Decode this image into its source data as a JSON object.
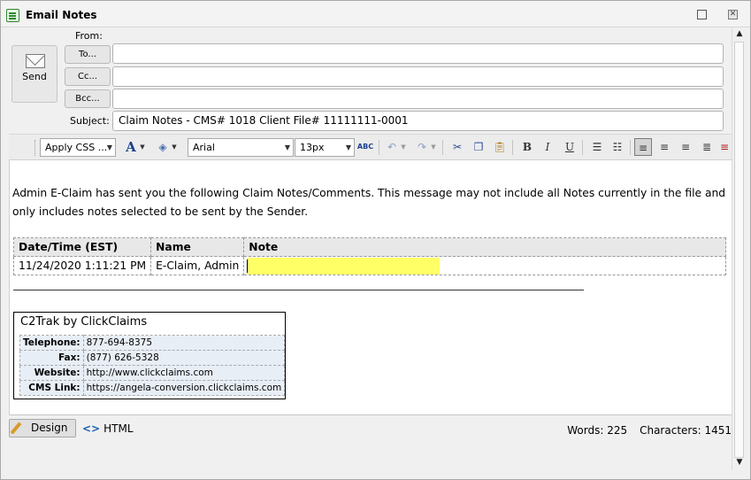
{
  "window": {
    "title": "Email Notes",
    "maximize_glyph": "□",
    "close_glyph": "✕"
  },
  "compose": {
    "send_label": "Send",
    "from_label": "From:",
    "to_button": "To...",
    "cc_button": "Cc...",
    "bcc_button": "Bcc...",
    "to_value": "",
    "cc_value": "",
    "bcc_value": "",
    "subject_label": "Subject:",
    "subject_value": "Claim Notes - CMS# 1018 Client File# 11111111-0001"
  },
  "toolbar": {
    "apply_css": "Apply CSS ...",
    "font_name": "Arial",
    "font_size": "13px",
    "icons": [
      "font-color-icon",
      "highlight-color-icon",
      "spellcheck-icon",
      "undo-icon",
      "redo-icon",
      "cut-icon",
      "copy-icon",
      "paste-icon",
      "bold-icon",
      "italic-icon",
      "underline-icon",
      "numbered-list-icon",
      "bullet-list-icon",
      "align-left-icon",
      "align-center-icon",
      "align-right-icon",
      "justify-icon"
    ],
    "bold": "B",
    "italic": "I",
    "underline": "U",
    "font_color": "A",
    "spell": "ABC"
  },
  "editor": {
    "intro_text": "Admin E-Claim has sent you the following Claim Notes/Comments. This message may not include all Notes currently in the file and only includes notes selected to be sent by the Sender.",
    "table_headers": [
      "Date/Time (EST)",
      "Name",
      "Note"
    ],
    "table_rows": [
      [
        "11/24/2020 1:11:21 PM",
        "E-Claim, Admin",
        ""
      ]
    ],
    "signature": {
      "title": "C2Trak by ClickClaims",
      "rows": [
        {
          "label": "Telephone:",
          "value": "877-694-8375"
        },
        {
          "label": "Fax:",
          "value": "(877) 626-5328"
        },
        {
          "label": "Website:",
          "value": "http://www.clickclaims.com"
        },
        {
          "label": "CMS Link:",
          "value": "https://angela-conversion.clickclaims.com"
        }
      ]
    }
  },
  "bottom": {
    "design_label": "Design",
    "html_label": "HTML",
    "html_glyph": "<>",
    "words": "Words: 225",
    "characters": "Characters: 1451"
  },
  "colors": {
    "note_highlight": "#ffff66",
    "signature_bg": "#e8eef6"
  }
}
